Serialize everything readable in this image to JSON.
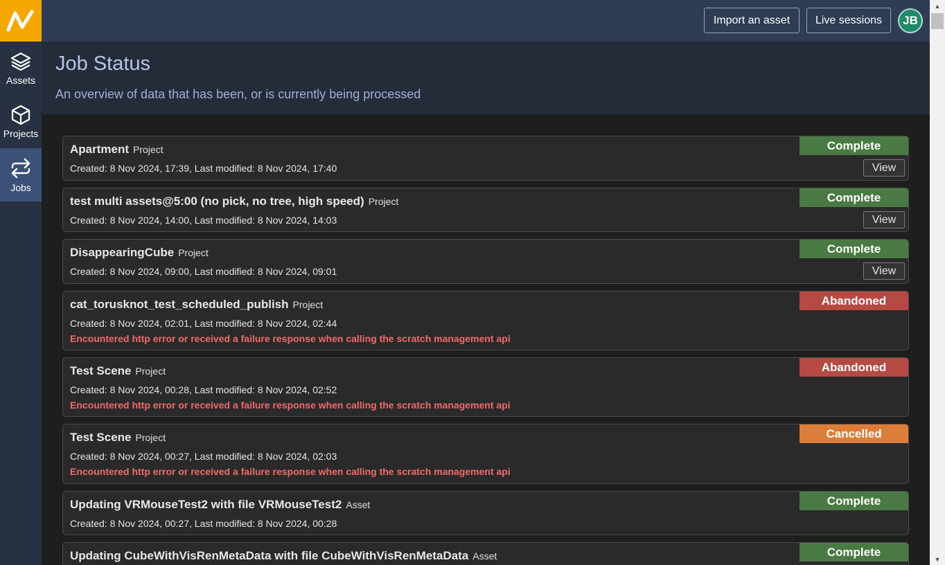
{
  "sidebar": {
    "logo": "V",
    "items": [
      {
        "label": "Assets",
        "icon": "layers-icon"
      },
      {
        "label": "Projects",
        "icon": "cube-icon"
      },
      {
        "label": "Jobs",
        "icon": "sync-arrows-icon"
      }
    ],
    "active": "Jobs"
  },
  "topbar": {
    "import_label": "Import an asset",
    "live_label": "Live sessions",
    "avatar_initials": "JB"
  },
  "header": {
    "title": "Job Status",
    "subtitle": "An overview of data that has been, or is currently being processed"
  },
  "view_label": "View",
  "jobs": [
    {
      "name": "Apartment",
      "type": "Project",
      "dates": "Created: 8 Nov 2024, 17:39, Last modified: 8 Nov 2024, 17:40",
      "status": "Complete",
      "error": ""
    },
    {
      "name": "test multi assets@5:00 (no pick, no tree, high speed)",
      "type": "Project",
      "dates": "Created: 8 Nov 2024, 14:00, Last modified: 8 Nov 2024, 14:03",
      "status": "Complete",
      "error": ""
    },
    {
      "name": "DisappearingCube",
      "type": "Project",
      "dates": "Created: 8 Nov 2024, 09:00, Last modified: 8 Nov 2024, 09:01",
      "status": "Complete",
      "error": ""
    },
    {
      "name": "cat_torusknot_test_scheduled_publish",
      "type": "Project",
      "dates": "Created: 8 Nov 2024, 02:01, Last modified: 8 Nov 2024, 02:44",
      "status": "Abandoned",
      "error": "Encountered http error or received a failure response when calling the scratch management api"
    },
    {
      "name": "Test Scene",
      "type": "Project",
      "dates": "Created: 8 Nov 2024, 00:28, Last modified: 8 Nov 2024, 02:52",
      "status": "Abandoned",
      "error": "Encountered http error or received a failure response when calling the scratch management api"
    },
    {
      "name": "Test Scene",
      "type": "Project",
      "dates": "Created: 8 Nov 2024, 00:27, Last modified: 8 Nov 2024, 02:03",
      "status": "Cancelled",
      "error": "Encountered http error or received a failure response when calling the scratch management api"
    },
    {
      "name": "Updating VRMouseTest2 with file VRMouseTest2",
      "type": "Asset",
      "dates": "Created: 8 Nov 2024, 00:27, Last modified: 8 Nov 2024, 00:28",
      "status": "Complete",
      "error": ""
    },
    {
      "name": "Updating CubeWithVisRenMetaData with file CubeWithVisRenMetaData",
      "type": "Asset",
      "dates": "",
      "status": "Complete",
      "error": ""
    }
  ],
  "colors": {
    "complete": "#4a7a43",
    "abandoned": "#b54a43",
    "cancelled": "#dc7d3a",
    "logo_bg": "#f5a700",
    "error_text": "#f26a6a"
  }
}
